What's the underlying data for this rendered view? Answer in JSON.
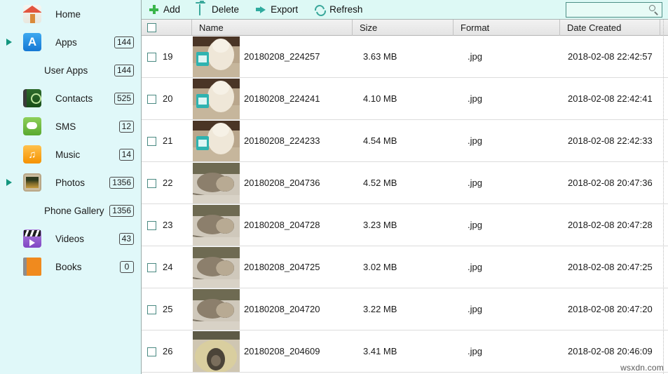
{
  "sidebar": {
    "items": [
      {
        "label": "Home",
        "icon": "home-icon",
        "count": null,
        "expandable": false,
        "sub": false
      },
      {
        "label": "Apps",
        "icon": "apps-icon",
        "count": "144",
        "expandable": true,
        "sub": false
      },
      {
        "label": "User Apps",
        "icon": null,
        "count": "144",
        "expandable": false,
        "sub": true
      },
      {
        "label": "Contacts",
        "icon": "contacts-icon",
        "count": "525",
        "expandable": false,
        "sub": false
      },
      {
        "label": "SMS",
        "icon": "sms-icon",
        "count": "12",
        "expandable": false,
        "sub": false
      },
      {
        "label": "Music",
        "icon": "music-icon",
        "count": "14",
        "expandable": false,
        "sub": false
      },
      {
        "label": "Photos",
        "icon": "photos-icon",
        "count": "1356",
        "expandable": true,
        "sub": false
      },
      {
        "label": "Phone Gallery",
        "icon": null,
        "count": "1356",
        "expandable": false,
        "sub": true
      },
      {
        "label": "Videos",
        "icon": "videos-icon",
        "count": "43",
        "expandable": false,
        "sub": false
      },
      {
        "label": "Books",
        "icon": "books-icon",
        "count": "0",
        "expandable": false,
        "sub": false
      }
    ]
  },
  "toolbar": {
    "buttons": [
      {
        "label": "Add",
        "icon": "plus-icon"
      },
      {
        "label": "Delete",
        "icon": "trash-icon"
      },
      {
        "label": "Export",
        "icon": "export-arrow-icon"
      },
      {
        "label": "Refresh",
        "icon": "refresh-icon"
      }
    ]
  },
  "search": {
    "value": "",
    "placeholder": "",
    "icon": "search-icon"
  },
  "table": {
    "columns": [
      {
        "key": "check",
        "label": ""
      },
      {
        "key": "name",
        "label": "Name"
      },
      {
        "key": "size",
        "label": "Size"
      },
      {
        "key": "format",
        "label": "Format"
      },
      {
        "key": "date",
        "label": "Date Created"
      }
    ],
    "rows": [
      {
        "index": "19",
        "name": "20180208_224257",
        "size": "3.63 MB",
        "format": ".jpg",
        "date": "2018-02-08 22:42:57",
        "thumb": "dog-with-bag"
      },
      {
        "index": "20",
        "name": "20180208_224241",
        "size": "4.10 MB",
        "format": ".jpg",
        "date": "2018-02-08 22:42:41",
        "thumb": "dog-with-bag"
      },
      {
        "index": "21",
        "name": "20180208_224233",
        "size": "4.54 MB",
        "format": ".jpg",
        "date": "2018-02-08 22:42:33",
        "thumb": "dog-with-bag"
      },
      {
        "index": "22",
        "name": "20180208_204736",
        "size": "4.52 MB",
        "format": ".jpg",
        "date": "2018-02-08 20:47:36",
        "thumb": "pet-on-floor"
      },
      {
        "index": "23",
        "name": "20180208_204728",
        "size": "3.23 MB",
        "format": ".jpg",
        "date": "2018-02-08 20:47:28",
        "thumb": "pet-on-floor"
      },
      {
        "index": "24",
        "name": "20180208_204725",
        "size": "3.02 MB",
        "format": ".jpg",
        "date": "2018-02-08 20:47:25",
        "thumb": "pet-on-floor"
      },
      {
        "index": "25",
        "name": "20180208_204720",
        "size": "3.22 MB",
        "format": ".jpg",
        "date": "2018-02-08 20:47:20",
        "thumb": "pet-on-floor"
      },
      {
        "index": "26",
        "name": "20180208_204609",
        "size": "3.41 MB",
        "format": ".jpg",
        "date": "2018-02-08 20:46:09",
        "thumb": "straw-nest"
      }
    ]
  },
  "watermark": {
    "text": "wsxdn.com"
  },
  "colors": {
    "sidebar_bg": "#e0f8f9",
    "toolbar_bg": "#ddf9f5",
    "accent_teal": "#3aa89b",
    "accent_green": "#39b54a",
    "header_bg": "#eeeeee"
  }
}
